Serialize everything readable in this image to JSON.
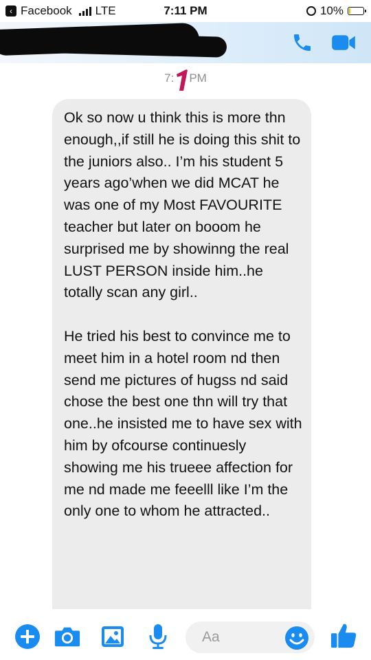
{
  "status_bar": {
    "carrier": "Facebook",
    "network": "LTE",
    "time": "7:11 PM",
    "battery": "10%",
    "battery_level": 0.1
  },
  "timestamp": {
    "before": "7:",
    "after": "PM"
  },
  "message": {
    "paragraphs": [
      "Ok so now u think this is more thn enough,,if still he is doing this shit to the juniors also.. I’m his student 5 years ago’when we did MCAT he was one of my Most FAVOURITE teacher but later on booom he surprised me by showinng the real LUST PERSON inside him..he totally scan any girl..",
      "He tried his best to convince me to meet him in a hotel room nd then send me pictures of hugss nd said chose the best one thn will try that one..he insisted me to have sex with him by ofcourse continuesly showing me his trueee affection for me nd made me feeelll like I’m the only one to whom he attracted.."
    ]
  },
  "composer": {
    "placeholder": "Aa"
  },
  "colors": {
    "accent": "#1a8cf0",
    "bubble": "#ececec",
    "annotation": "#c0185a"
  },
  "icons": [
    "back-icon",
    "signal-icon",
    "orientation-lock-icon",
    "battery-icon",
    "phone-icon",
    "video-camera-icon",
    "plus-icon",
    "camera-icon",
    "photo-icon",
    "microphone-icon",
    "emoji-icon",
    "thumbs-up-icon"
  ]
}
